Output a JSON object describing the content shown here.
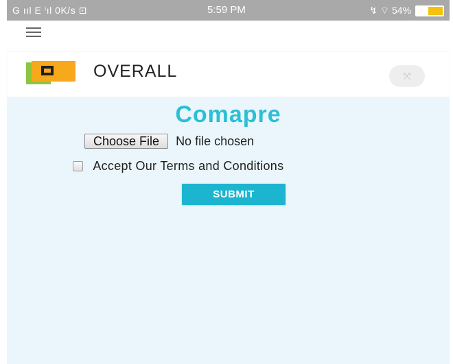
{
  "status_bar": {
    "left_text": "G ııl E ⁱıl 0K/s ⊡",
    "time": "5:59 PM",
    "right_text": "↯ ⌔ 54%",
    "battery_percent": 54,
    "bar_color": "#a9a9a9",
    "battery_color": "#f4c20d"
  },
  "nav": {
    "menu_icon": "hamburger-icon"
  },
  "header": {
    "brand_name": "OVERALL",
    "logo_icon": "overall-logo",
    "expand_icon": "expand-arrows-icon",
    "expand_glyph": "⤧"
  },
  "form": {
    "title": "Comapre",
    "choose_file_label": "Choose File",
    "file_status": "No file chosen",
    "terms_label": "Accept Our Terms and Conditions",
    "terms_checked": false,
    "submit_label": "SUBMIT"
  },
  "colors": {
    "accent": "#1cb5d0",
    "title": "#2bbfd6",
    "content_bg": "#eaf6fb",
    "logo_green": "#8cc63f",
    "logo_orange": "#f7a81b"
  }
}
